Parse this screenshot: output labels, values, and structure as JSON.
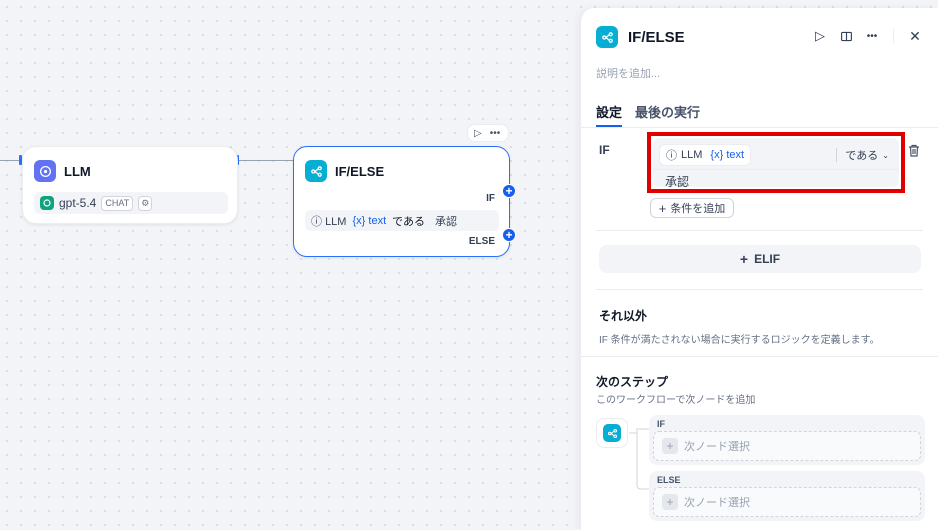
{
  "canvas": {
    "llm_node": {
      "title": "LLM",
      "model": "gpt-5.4",
      "mode_chip": "CHAT"
    },
    "ifelse_node": {
      "title": "IF/ELSE",
      "if_label": "IF",
      "else_label": "ELSE",
      "condition": {
        "source": "LLM",
        "var_prefix": "{x}",
        "var_name": "text",
        "operator": "である",
        "value": "承認"
      }
    }
  },
  "panel": {
    "title": "IF/ELSE",
    "description_placeholder": "説明を追加...",
    "tabs": [
      {
        "label": "設定",
        "active": true
      },
      {
        "label": "最後の実行",
        "active": false
      }
    ],
    "if_label": "IF",
    "condition": {
      "source": "LLM",
      "var_prefix": "{x}",
      "var_name": "text",
      "operator": "である",
      "value": "承認"
    },
    "add_condition_label": "条件を追加",
    "elif_label": "ELIF",
    "else_section": {
      "title": "それ以外",
      "description": "IF 条件が満たされない場合に実行するロジックを定義します。"
    },
    "next_step": {
      "title": "次のステップ",
      "description": "このワークフローで次ノードを追加",
      "branches": [
        {
          "label": "IF",
          "select_placeholder": "次ノード選択"
        },
        {
          "label": "ELSE",
          "select_placeholder": "次ノード選択"
        }
      ]
    }
  },
  "colors": {
    "accent": "#155eef",
    "llm_icon": "#6172f3",
    "ifelse_icon": "#06aed4",
    "highlight": "#e00000"
  }
}
